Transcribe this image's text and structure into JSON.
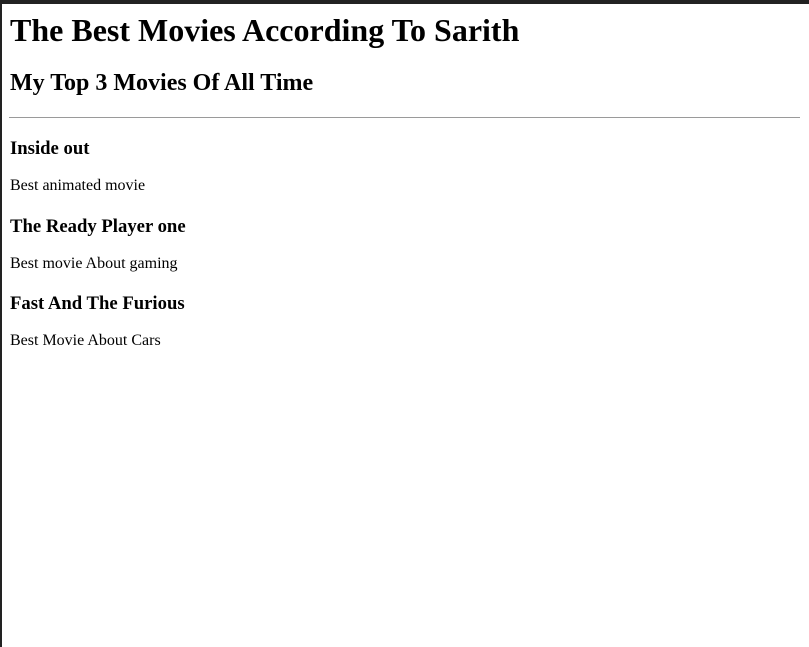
{
  "page": {
    "title": "The Best Movies According To Sarith",
    "subtitle": "My Top 3 Movies Of All Time"
  },
  "movies": [
    {
      "title": "Inside out",
      "description": "Best animated movie"
    },
    {
      "title": "The Ready Player one",
      "description": "Best movie About gaming"
    },
    {
      "title": "Fast And The Furious",
      "description": "Best Movie About Cars"
    }
  ]
}
